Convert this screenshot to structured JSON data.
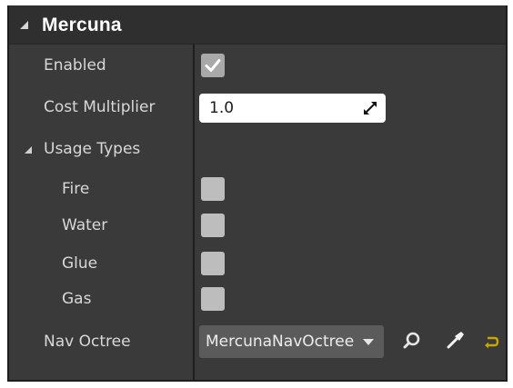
{
  "panel": {
    "title": "Mercuna",
    "colors": {
      "background": "#3a3a3a",
      "header": "#2f2f2f",
      "text": "#d8d8d8",
      "reset_arrow": "#c8a500"
    }
  },
  "properties": {
    "enabled": {
      "label": "Enabled",
      "checked": true
    },
    "cost_multiplier": {
      "label": "Cost Multiplier",
      "value": "1.0"
    },
    "usage_types": {
      "label": "Usage Types",
      "expanded": true,
      "items": [
        {
          "label": "Fire",
          "checked": false
        },
        {
          "label": "Water",
          "checked": false
        },
        {
          "label": "Glue",
          "checked": false
        },
        {
          "label": "Gas",
          "checked": false
        }
      ]
    },
    "nav_octree": {
      "label": "Nav Octree",
      "selected": "MercunaNavOctree",
      "icons": [
        "search-icon",
        "picker-icon",
        "reset-arrow-icon"
      ]
    }
  }
}
